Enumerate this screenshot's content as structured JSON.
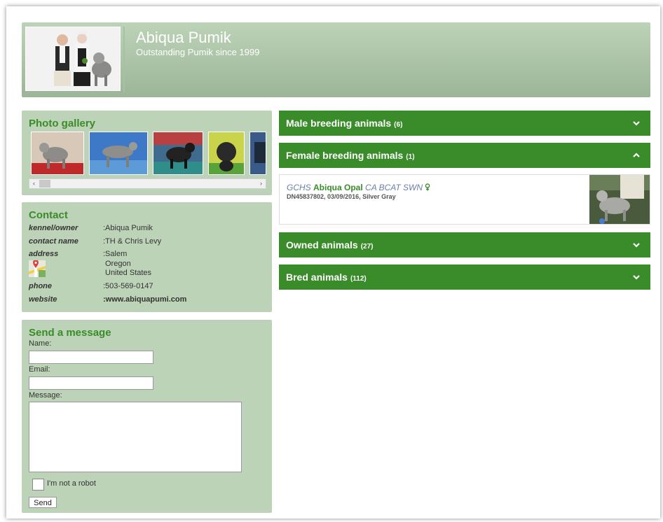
{
  "header": {
    "title": "Abiqua Pumik",
    "subtitle": "Outstanding Pumik since 1999"
  },
  "gallery": {
    "title": "Photo gallery",
    "scroll_left": "‹",
    "scroll_right": "›",
    "thumbnail_count": 5
  },
  "contact": {
    "title": "Contact",
    "rows": [
      {
        "label": "kennel/owner",
        "value": ":Abiqua Pumik"
      },
      {
        "label": "contact name",
        "value": ":TH & Chris Levy"
      },
      {
        "label": "address",
        "value": ":Salem"
      },
      {
        "label": "",
        "value": "Oregon"
      },
      {
        "label": "",
        "value": "United States"
      },
      {
        "label": "phone",
        "value": ":503-569-0147"
      },
      {
        "label": "website",
        "value": ":www.abiquapumi.com"
      }
    ],
    "map_icon": "google-maps-icon"
  },
  "message": {
    "title": "Send a message",
    "name_label": "Name:",
    "email_label": "Email:",
    "message_label": "Message:",
    "captcha_label": "I'm not a robot",
    "send_label": "Send"
  },
  "sections": [
    {
      "label": "Male breeding animals",
      "count": "(6)",
      "expanded": false
    },
    {
      "label": "Female breeding animals",
      "count": "(1)",
      "expanded": true
    },
    {
      "label": "Owned animals",
      "count": "(27)",
      "expanded": false
    },
    {
      "label": "Bred animals",
      "count": "(112)",
      "expanded": false
    }
  ],
  "female_animal": {
    "title_prefix": "GCHS",
    "name": "Abiqua Opal",
    "suffix": "CA BCAT SWN",
    "sex_icon": "female-symbol-icon",
    "info": "DN45837802, 03/09/2016, Silver Gray"
  },
  "colors": {
    "accent_green": "#3a8b2a",
    "panel_green": "#bcd3b7",
    "title_blue": "#6b7fa8"
  }
}
